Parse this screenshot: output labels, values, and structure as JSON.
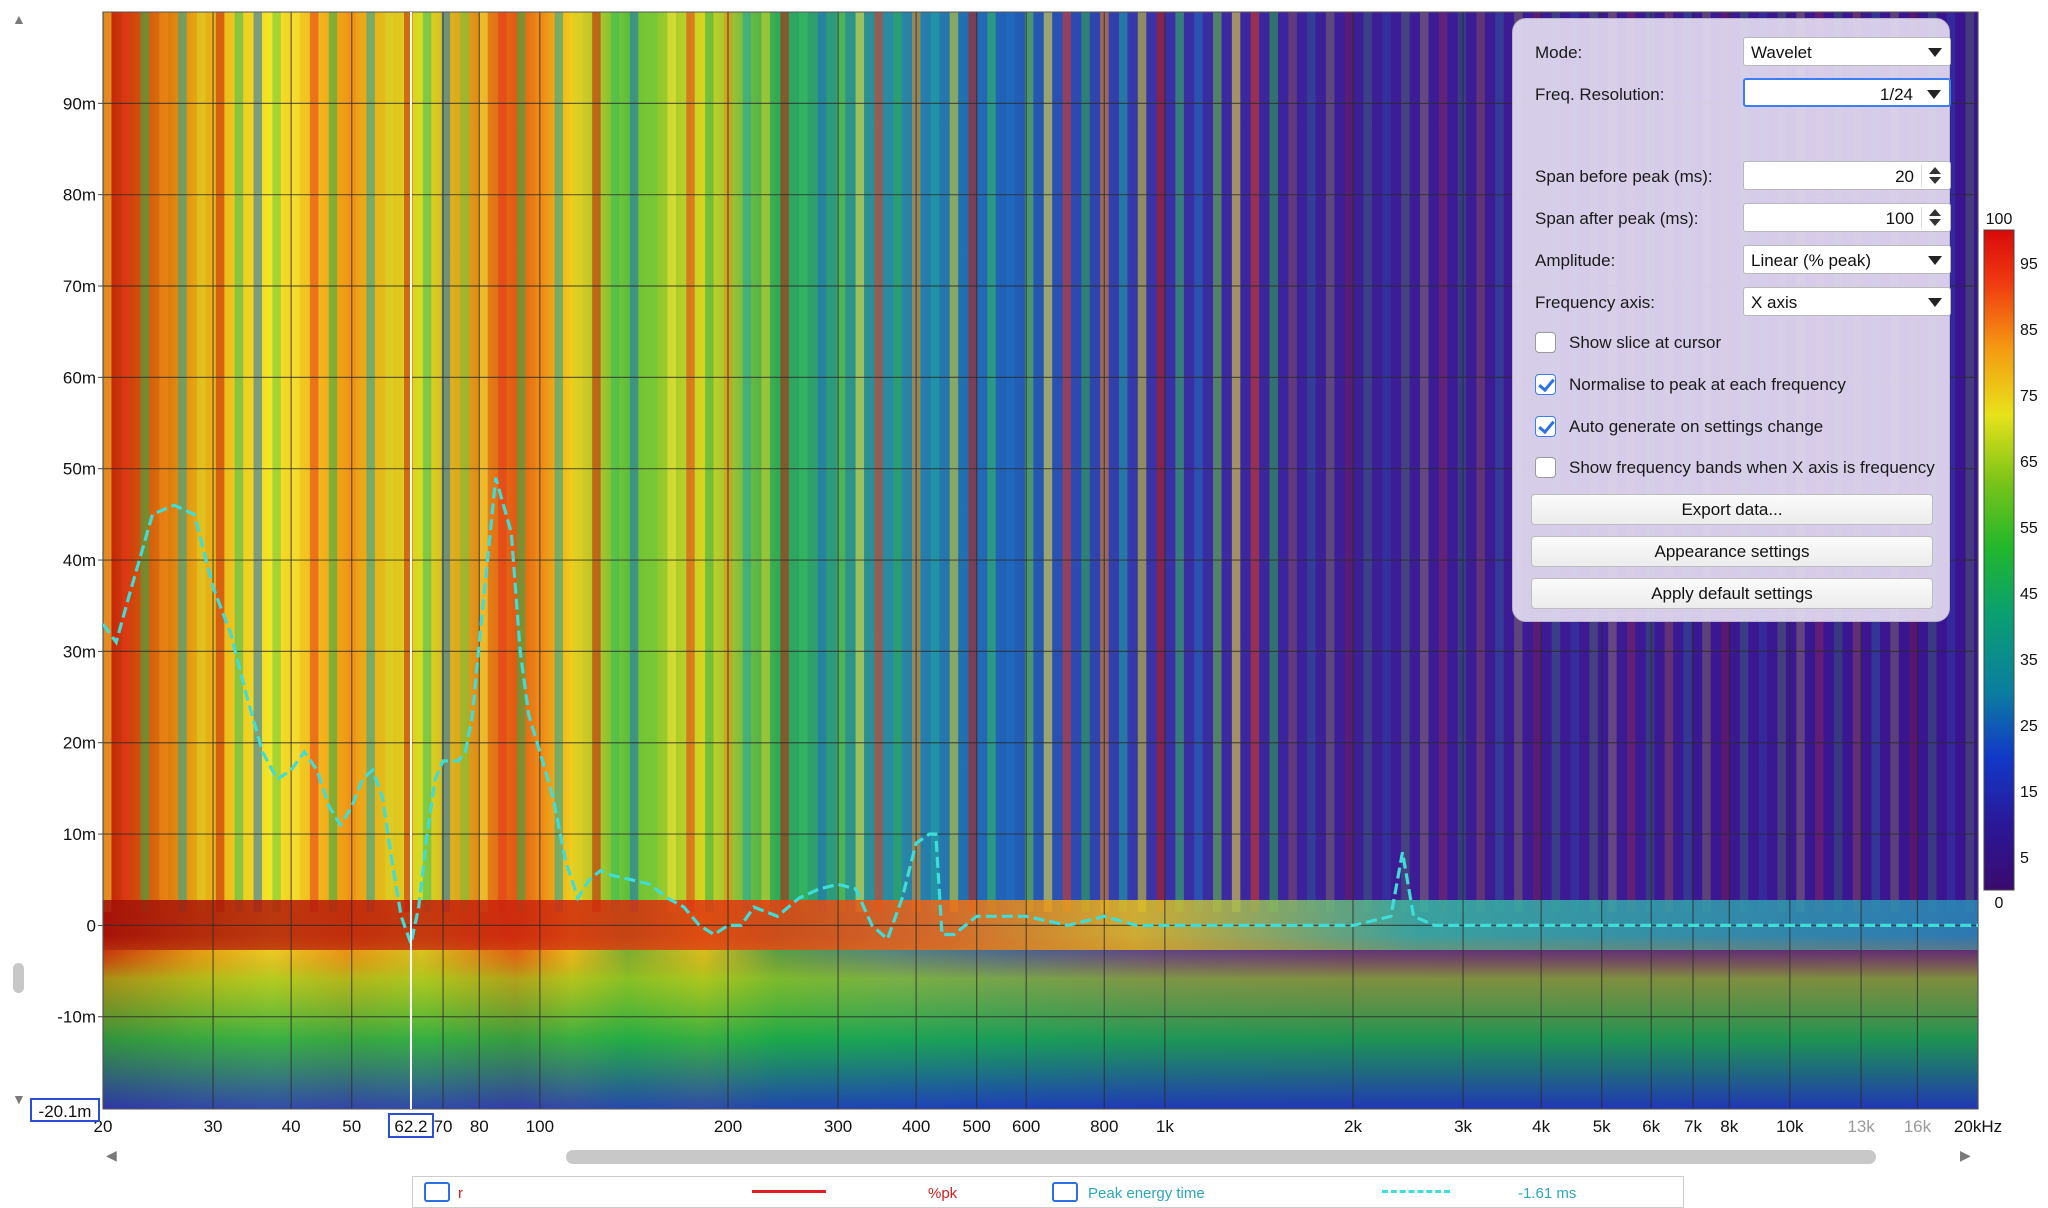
{
  "chart_data": {
    "type": "heatmap",
    "title": "",
    "xlabel": "",
    "ylabel": "",
    "x_scale": "log",
    "xlim": [
      20,
      20000
    ],
    "ylim": [
      -0.0201,
      0.1
    ],
    "x_ticks": [
      {
        "v": 20,
        "label": "20",
        "major": true
      },
      {
        "v": 30,
        "label": "30",
        "major": true
      },
      {
        "v": 40,
        "label": "40",
        "major": true
      },
      {
        "v": 50,
        "label": "50",
        "major": true
      },
      {
        "v": 70,
        "label": "70",
        "major": true
      },
      {
        "v": 80,
        "label": "80",
        "major": true
      },
      {
        "v": 100,
        "label": "100",
        "major": true
      },
      {
        "v": 200,
        "label": "200",
        "major": true
      },
      {
        "v": 300,
        "label": "300",
        "major": true
      },
      {
        "v": 400,
        "label": "400",
        "major": true
      },
      {
        "v": 500,
        "label": "500",
        "major": true
      },
      {
        "v": 600,
        "label": "600",
        "major": true
      },
      {
        "v": 800,
        "label": "800",
        "major": true
      },
      {
        "v": 1000,
        "label": "1k",
        "major": true
      },
      {
        "v": 2000,
        "label": "2k",
        "major": true
      },
      {
        "v": 3000,
        "label": "3k",
        "major": true
      },
      {
        "v": 4000,
        "label": "4k",
        "major": true
      },
      {
        "v": 5000,
        "label": "5k",
        "major": true
      },
      {
        "v": 6000,
        "label": "6k",
        "major": true
      },
      {
        "v": 7000,
        "label": "7k",
        "major": true
      },
      {
        "v": 8000,
        "label": "8k",
        "major": true
      },
      {
        "v": 10000,
        "label": "10k",
        "major": true
      },
      {
        "v": 13000,
        "label": "13k",
        "major": false
      },
      {
        "v": 16000,
        "label": "16k",
        "major": false
      },
      {
        "v": 20000,
        "label": "20kHz",
        "major": true
      }
    ],
    "y_ticks": [
      {
        "v": 0.09,
        "label": "90m"
      },
      {
        "v": 0.08,
        "label": "80m"
      },
      {
        "v": 0.07,
        "label": "70m"
      },
      {
        "v": 0.06,
        "label": "60m"
      },
      {
        "v": 0.05,
        "label": "50m"
      },
      {
        "v": 0.04,
        "label": "40m"
      },
      {
        "v": 0.03,
        "label": "30m"
      },
      {
        "v": 0.02,
        "label": "20m"
      },
      {
        "v": 0.01,
        "label": "10m"
      },
      {
        "v": 0.0,
        "label": "0"
      },
      {
        "v": -0.01,
        "label": "-10m"
      }
    ],
    "cursor": {
      "x": 62.2,
      "x_label": "62.2",
      "y_label": "-20.1m"
    },
    "series": [
      {
        "x": [
          20,
          21,
          22,
          24,
          26,
          28,
          30,
          32,
          34,
          36,
          38,
          40,
          42,
          44,
          46,
          48,
          50,
          52,
          54,
          56,
          58,
          60,
          62.2,
          64,
          66,
          68,
          70,
          72,
          74,
          76,
          78,
          80,
          85,
          90,
          93,
          96,
          100,
          105,
          110,
          115,
          120,
          125,
          130,
          140,
          150,
          160,
          170,
          180,
          190,
          200,
          210,
          220,
          240,
          260,
          280,
          300,
          320,
          340,
          360,
          380,
          400,
          420,
          430,
          440,
          460,
          500,
          550,
          600,
          700,
          800,
          900,
          1000,
          1200,
          1500,
          2000,
          2300,
          2400,
          2500,
          2600,
          2700,
          3000,
          4000,
          5000,
          7000,
          10000,
          14000,
          20000
        ],
        "values": [
          0.033,
          0.031,
          0.036,
          0.045,
          0.046,
          0.045,
          0.037,
          0.032,
          0.025,
          0.019,
          0.016,
          0.017,
          0.019,
          0.017,
          0.013,
          0.011,
          0.013,
          0.016,
          0.017,
          0.014,
          0.007,
          0.001,
          -0.002,
          0.002,
          0.01,
          0.016,
          0.018,
          0.018,
          0.018,
          0.019,
          0.023,
          0.031,
          0.049,
          0.043,
          0.03,
          0.023,
          0.019,
          0.014,
          0.007,
          0.003,
          0.005,
          0.006,
          0.0055,
          0.005,
          0.0045,
          0.003,
          0.002,
          0.0,
          -0.001,
          0.0,
          0.0,
          0.002,
          0.001,
          0.003,
          0.004,
          0.0045,
          0.004,
          0.0,
          -0.0015,
          0.003,
          0.009,
          0.01,
          0.01,
          -0.001,
          -0.001,
          0.001,
          0.001,
          0.001,
          0.0,
          0.001,
          0.0,
          0.0,
          0.0,
          0.0,
          0.0,
          0.001,
          0.008,
          0.001,
          0.0005,
          0.0,
          0.0,
          0.0,
          0.0,
          0.0,
          0.0,
          0.0,
          0.0
        ]
      }
    ],
    "colorbar": {
      "min": 0,
      "max": 100,
      "labels": [
        100,
        95,
        85,
        75,
        65,
        55,
        45,
        35,
        25,
        15,
        5,
        0
      ]
    },
    "colors": {
      "trace": "#3fdcd8",
      "cursor": "#ffffff",
      "cursor_box": "#2a4fd6",
      "grid": "#2a2a2a"
    }
  },
  "controls": {
    "mode_label": "Mode:",
    "mode_value": "Wavelet",
    "freq_res_label": "Freq. Resolution:",
    "freq_res_value": "1/24",
    "span_before_label": "Span before peak (ms):",
    "span_before_value": "20",
    "span_after_label": "Span after peak (ms):",
    "span_after_value": "100",
    "amplitude_label": "Amplitude:",
    "amplitude_value": "Linear (% peak)",
    "freq_axis_label": "Frequency axis:",
    "freq_axis_value": "X axis",
    "show_slice_label": "Show slice at cursor",
    "show_slice_checked": false,
    "normalise_label": "Normalise to peak at each frequency",
    "normalise_checked": true,
    "auto_generate_label": "Auto generate on settings change",
    "auto_generate_checked": true,
    "show_bands_label": "Show frequency bands when X axis is frequency",
    "show_bands_checked": false,
    "export_label": "Export data...",
    "appearance_label": "Appearance settings",
    "defaults_label": "Apply default settings"
  },
  "legend": {
    "item1_label": "r",
    "item1_unit": "%pk",
    "item2_label": "Peak energy time",
    "item2_value": "-1.61 ms"
  }
}
